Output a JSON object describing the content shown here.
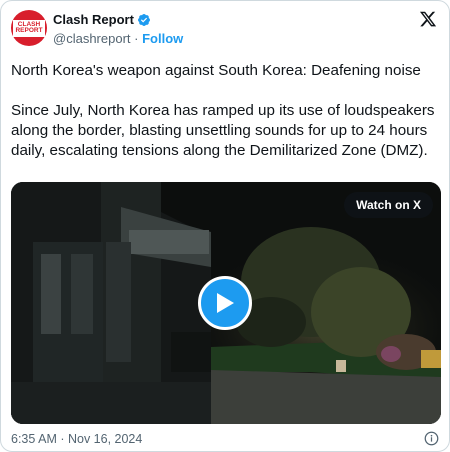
{
  "account": {
    "display_name": "Clash Report",
    "handle": "@clashreport",
    "separator": "·",
    "follow_label": "Follow",
    "avatar_text_line1": "CLASH",
    "avatar_text_line2": "REPORT"
  },
  "tweet": {
    "headline": "North Korea's weapon against South Korea: Deafening noise",
    "body": "Since July, North Korea has ramped up its use of loudspeakers along the border, blasting unsettling sounds for up to 24 hours daily, escalating tensions along the Demilitarized Zone (DMZ).",
    "timestamp": "6:35 AM · Nov 16, 2024"
  },
  "media": {
    "watch_label": "Watch on X"
  },
  "colors": {
    "accent": "#1d9bf0",
    "brand_red": "#d81e2c",
    "muted_text": "#536471"
  },
  "icons": [
    "verified-badge-icon",
    "x-logo-icon",
    "play-icon",
    "info-icon"
  ]
}
